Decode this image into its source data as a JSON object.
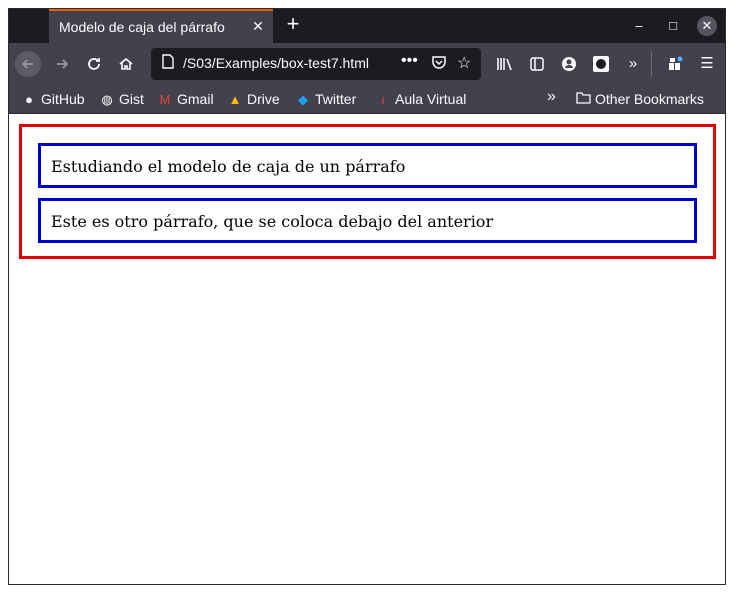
{
  "browser": {
    "tab_title": "Modelo de caja del párrafo",
    "tab_close_glyph": "✕",
    "new_tab_glyph": "+",
    "url": "/S03/Examples/box-test7.html",
    "url_more_glyph": "•••",
    "window_controls": {
      "minimize": "–",
      "maximize": "□",
      "close": "✕"
    }
  },
  "bookmarks": [
    {
      "label": "GitHub",
      "icon": "github-icon"
    },
    {
      "label": "Gist",
      "icon": "globe-icon"
    },
    {
      "label": "Gmail",
      "icon": "gmail-icon"
    },
    {
      "label": "Drive",
      "icon": "drive-icon"
    },
    {
      "label": "Twitter",
      "icon": "twitter-icon"
    },
    {
      "label": "Aula Virtual",
      "icon": "aula-icon"
    }
  ],
  "bookmarks_other": "Other Bookmarks",
  "page": {
    "paragraphs": [
      "Estudiando el modelo de caja de un párrafo",
      "Este es otro párrafo, que se coloca debajo del anterior"
    ]
  },
  "colors": {
    "outer_border": "#e00000",
    "paragraph_border": "#0000cc",
    "chrome_dark": "#1c1b22",
    "chrome": "#42414d",
    "tab_accent": "#e66100"
  }
}
